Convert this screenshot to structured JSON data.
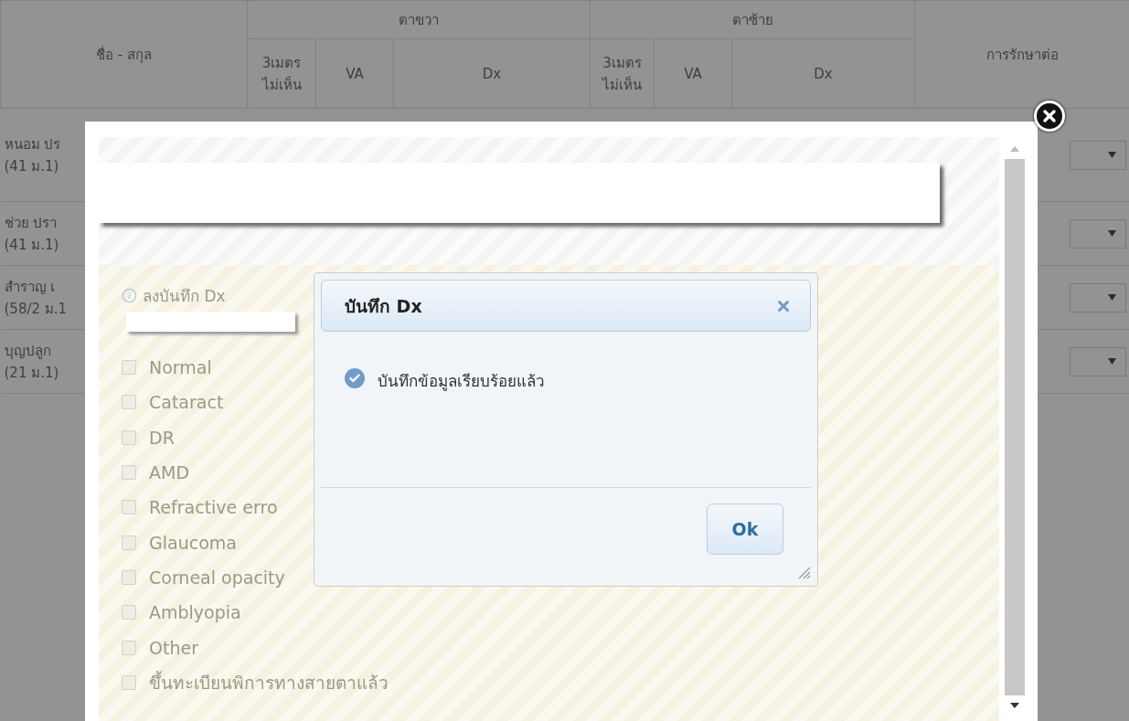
{
  "table": {
    "name_header": "ชื่อ - สกุล",
    "eye_groups": [
      {
        "label": "ตาขวา",
        "columns": [
          "3เมตร ไม่เห็น",
          "VA",
          "Dx"
        ]
      },
      {
        "label": "ตาซ้าย",
        "columns": [
          "3เมตร ไม่เห็น",
          "VA",
          "Dx"
        ]
      }
    ],
    "treatment_header": "การรักษาต่อ",
    "rows": [
      {
        "name": "หนอม ปร",
        "address": "(41 ม.1)"
      },
      {
        "name": "ช่วย ปรา",
        "address": "(41 ม.1)"
      },
      {
        "name": "สำราญ เ",
        "address": "(58/2 ม.1"
      },
      {
        "name": "บุญปลูก",
        "address": "(21 ม.1)"
      }
    ]
  },
  "modal": {
    "heading": "ลงบันทึก Dx",
    "options": [
      {
        "label": "Normal",
        "checked": false
      },
      {
        "label": "Cataract",
        "checked": false
      },
      {
        "label": "DR",
        "checked": false
      },
      {
        "label": "AMD",
        "checked": false
      },
      {
        "label": "Refractive erro",
        "checked": false
      },
      {
        "label": "Glaucoma",
        "checked": false
      },
      {
        "label": "Corneal opacity",
        "checked": false
      },
      {
        "label": "Amblyopia",
        "checked": false
      },
      {
        "label": "Other",
        "checked": false
      },
      {
        "label": "ขึ้นทะเบียนพิการทางสายตาแล้ว",
        "checked": false
      }
    ]
  },
  "dialog": {
    "title": "บันทึก Dx",
    "message": "บันทึกข้อมูลเรียบร้อยแล้ว",
    "buttons": [
      "Ok"
    ]
  }
}
